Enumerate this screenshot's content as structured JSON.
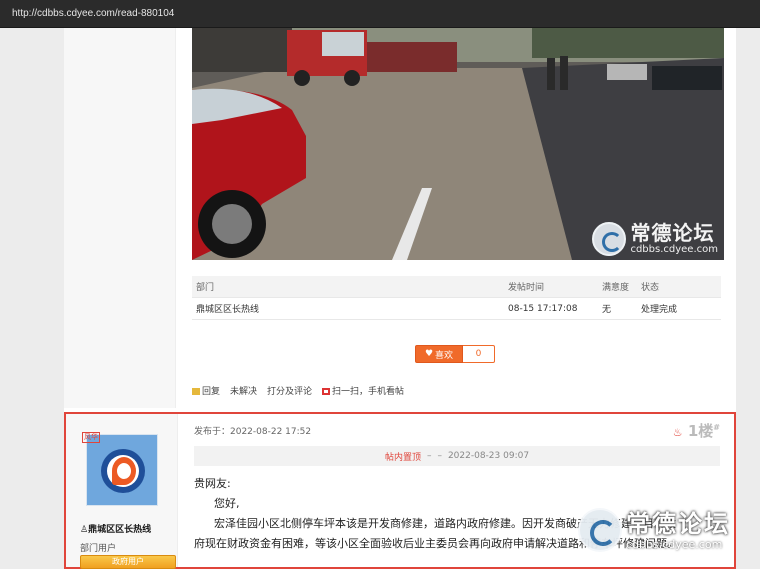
{
  "browser": {
    "url": "http://cdbbs.cdyee.com/read-880104"
  },
  "upper_post": {
    "watermark": {
      "cn": "常德论坛",
      "en": "cdbbs.cdyee.com"
    },
    "info_table": {
      "headers": [
        "部门",
        "发帖时间",
        "满意度",
        "状态"
      ],
      "rows": [
        [
          "鼎城区区长热线",
          "08-15 17:17:08",
          "无",
          "处理完成"
        ]
      ]
    },
    "like_label": "喜欢",
    "like_count": "0",
    "actions": [
      "回复",
      "未解决",
      "打分及评论",
      "扫一扫，手机看帖"
    ]
  },
  "lower_post": {
    "tag": "风华",
    "username": "鼎城区区长热线",
    "role": "部门用户",
    "badge": "政府用户",
    "posted_at": "发布于：2022-08-22 17:52",
    "floor": "1楼",
    "pin_label": "帖内置顶",
    "pin_time": "2022-08-23 09:07",
    "body": [
      "贵网友:",
      "您好,",
      "宏泽佳园小区北侧停车坪本该是开发商修建，道路内政府修建。因开发商破产无力修建，目前政",
      "府现在财政资金有困难，等该小区全面验收后业主委员会再向政府申请解决道路和停车坪修建问题。"
    ]
  },
  "overlay_watermark": {
    "cn": "常德论坛",
    "en": "cdbbs.cdyee.com"
  }
}
